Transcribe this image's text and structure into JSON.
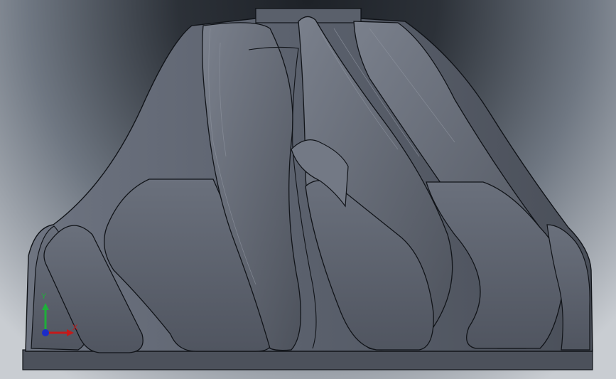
{
  "viewport": {
    "background_top": "#1e2228",
    "background_bottom": "#c9cdd2"
  },
  "model": {
    "name": "impeller-model",
    "face_color": "#5d6370",
    "edge_color": "#111419",
    "highlight_color": "#8d939e"
  },
  "triad": {
    "x_label": "X",
    "y_label": "Y",
    "x_color": "#c41a1a",
    "y_color": "#1fae3a",
    "z_color": "#1b2cc8"
  }
}
